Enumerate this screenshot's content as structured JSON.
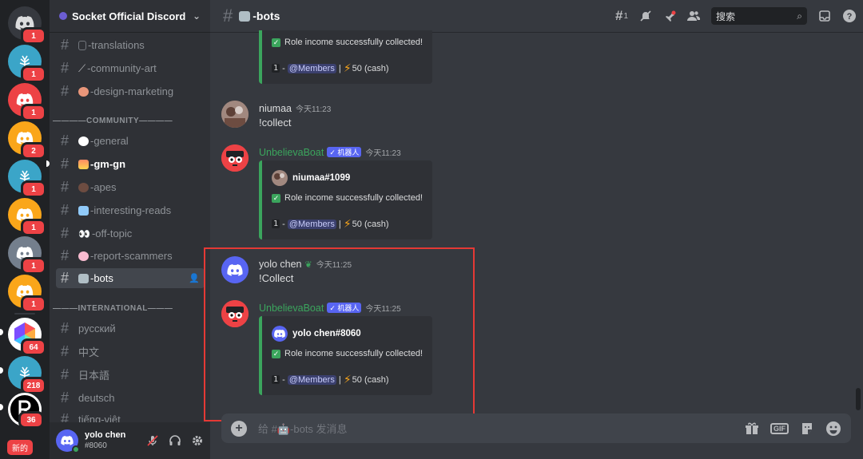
{
  "servers": [
    {
      "name": "home",
      "badge": "1",
      "color": "#36393f"
    },
    {
      "name": "tree-server",
      "badge": "1",
      "color": "#3ba5c8"
    },
    {
      "name": "red-server",
      "badge": "1",
      "color": "#ed4245"
    },
    {
      "name": "yellow-server",
      "badge": "2",
      "color": "#faa61a"
    },
    {
      "name": "tree-server-2",
      "badge": "1",
      "color": "#3ba5c8"
    },
    {
      "name": "yellow-server-2",
      "badge": "1",
      "color": "#faa61a"
    },
    {
      "name": "gray-server",
      "badge": "1",
      "color": "#747f8d"
    },
    {
      "name": "yellow-server-3",
      "badge": "1",
      "color": "#faa61a"
    },
    {
      "name": "socket-server",
      "badge": "64",
      "color": "#ffffff"
    },
    {
      "name": "tree-server-3",
      "badge": "218",
      "color": "#3ba5c8"
    },
    {
      "name": "r-server",
      "badge": "36",
      "color": "#000000"
    }
  ],
  "new_tag": "新的",
  "guild": {
    "name": "Socket Official Discord",
    "chevron": "⌄"
  },
  "channels": {
    "translations": "-translations",
    "community_art": "-community-art",
    "design_marketing": "-design-marketing",
    "cat_community": "————COMMUNITY————",
    "general": "-general",
    "gm_gn": "-gm-gn",
    "apes": "-apes",
    "interesting_reads": "-interesting-reads",
    "off_topic": "-off-topic",
    "report_scammers": "-report-scammers",
    "bots": "-bots",
    "cat_international": "———INTERNATIONAL———",
    "russian": "русский",
    "chinese": "中文",
    "japanese": "日本語",
    "deutsch": "deutsch",
    "vietnamese": "tiếng-việt"
  },
  "user": {
    "name": "yolo chen",
    "discriminator": "#8060"
  },
  "topbar": {
    "title": "-bots",
    "threads_count": "1",
    "search_placeholder": "搜索"
  },
  "messages": {
    "embed0": {
      "line1": "Role income successfully collected!",
      "prefix": "1",
      "dash": "-",
      "mention": "@Members",
      "sep": "|",
      "amount": "50 (cash)"
    },
    "m1": {
      "author": "niumaa",
      "time": "今天11:23",
      "text": "!collect"
    },
    "m2": {
      "author": "UnbelievaBoat",
      "badge": "✓ 机器人",
      "time": "今天11:23",
      "embed": {
        "author": "niumaa#1099",
        "line1": "Role income successfully collected!",
        "prefix": "1",
        "dash": "-",
        "mention": "@Members",
        "sep": "|",
        "amount": "50 (cash)"
      }
    },
    "m3": {
      "author": "yolo chen",
      "time": "今天11:25",
      "text": "!Collect"
    },
    "m4": {
      "author": "UnbelievaBoat",
      "badge": "✓ 机器人",
      "time": "今天11:25",
      "embed": {
        "author": "yolo chen#8060",
        "line1": "Role income successfully collected!",
        "prefix": "1",
        "dash": "-",
        "mention": "@Members",
        "sep": "|",
        "amount": "50 (cash)"
      }
    }
  },
  "composer": {
    "placeholder": "给 #🤖-bots 发消息",
    "gif_label": "GIF"
  },
  "colors": {
    "bot_name": "#3ba55d",
    "blurple": "#5865f2",
    "highlight": "#e53935"
  }
}
